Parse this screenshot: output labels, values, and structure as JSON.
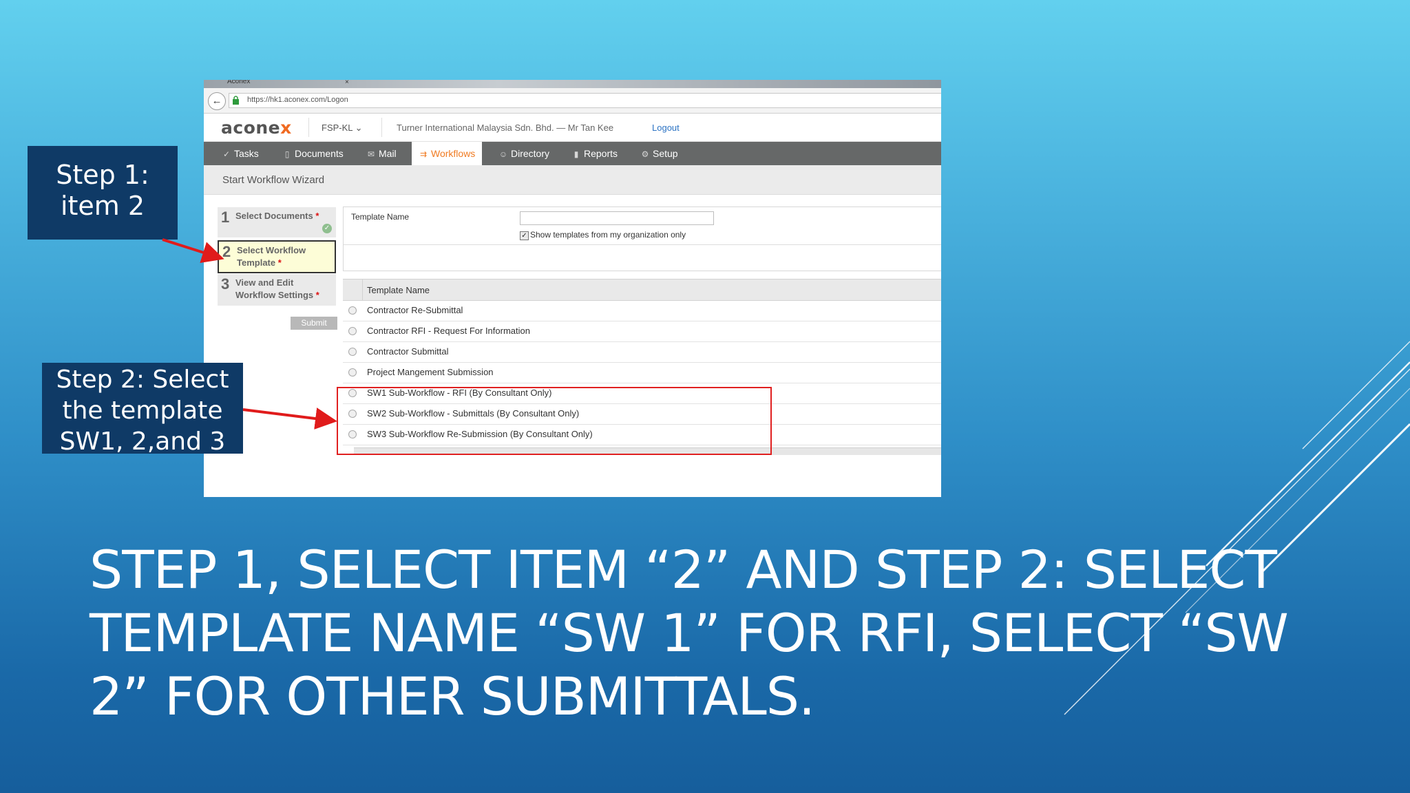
{
  "browser": {
    "tab_title": "Aconex",
    "tab_close": "×",
    "url": "https://hk1.aconex.com/Logon"
  },
  "app": {
    "logo_main": "acone",
    "logo_accent": "x",
    "org_selector": "FSP-KL",
    "company_user": "Turner International Malaysia Sdn. Bhd.  —  Mr Tan Kee",
    "logout": "Logout"
  },
  "nav": [
    {
      "label": "Tasks",
      "icon": "check-icon",
      "glyph": "✓"
    },
    {
      "label": "Documents",
      "icon": "document-icon",
      "glyph": "▯"
    },
    {
      "label": "Mail",
      "icon": "mail-icon",
      "glyph": "✉"
    },
    {
      "label": "Workflows",
      "icon": "workflow-icon",
      "glyph": "⇉"
    },
    {
      "label": "Directory",
      "icon": "people-icon",
      "glyph": "☺"
    },
    {
      "label": "Reports",
      "icon": "bar-chart-icon",
      "glyph": "▮"
    },
    {
      "label": "Setup",
      "icon": "gear-icon",
      "glyph": "⚙"
    }
  ],
  "wizard": {
    "title": "Start Workflow Wizard",
    "steps": [
      {
        "num": "1",
        "label": "Select Documents"
      },
      {
        "num": "2",
        "label": "Select Workflow Template"
      },
      {
        "num": "3",
        "label": "View and Edit Workflow Settings"
      }
    ],
    "required_mark": "*",
    "submit": "Submit"
  },
  "form": {
    "template_name_label": "Template Name",
    "template_name_value": "",
    "show_org_only_label": "Show templates from my organization only",
    "show_org_only_checked": true
  },
  "grid": {
    "header": "Template Name",
    "rows": [
      "Contractor Re-Submittal",
      "Contractor RFI - Request For Information",
      "Contractor Submittal",
      "Project Mangement Submission",
      "SW1 Sub-Workflow - RFI (By Consultant Only)",
      "SW2 Sub-Workflow - Submittals (By Consultant Only)",
      "SW3 Sub-Workflow Re-Submission (By Consultant Only)"
    ]
  },
  "callouts": {
    "step1_line1": "Step 1:",
    "step1_line2": "item 2",
    "step2_line1": "Step 2: Select",
    "step2_line2": "the template",
    "step2_line3": "SW1, 2,and 3"
  },
  "caption": "STEP 1, SELECT ITEM “2” AND STEP 2: SELECT TEMPLATE NAME “SW 1” FOR RFI, SELECT “SW 2” FOR OTHER SUBMITTALS.",
  "colors": {
    "highlight": "#e02020",
    "callout_bg": "#0f3a66",
    "nav_active": "#f07b22",
    "link": "#2d74c4"
  }
}
